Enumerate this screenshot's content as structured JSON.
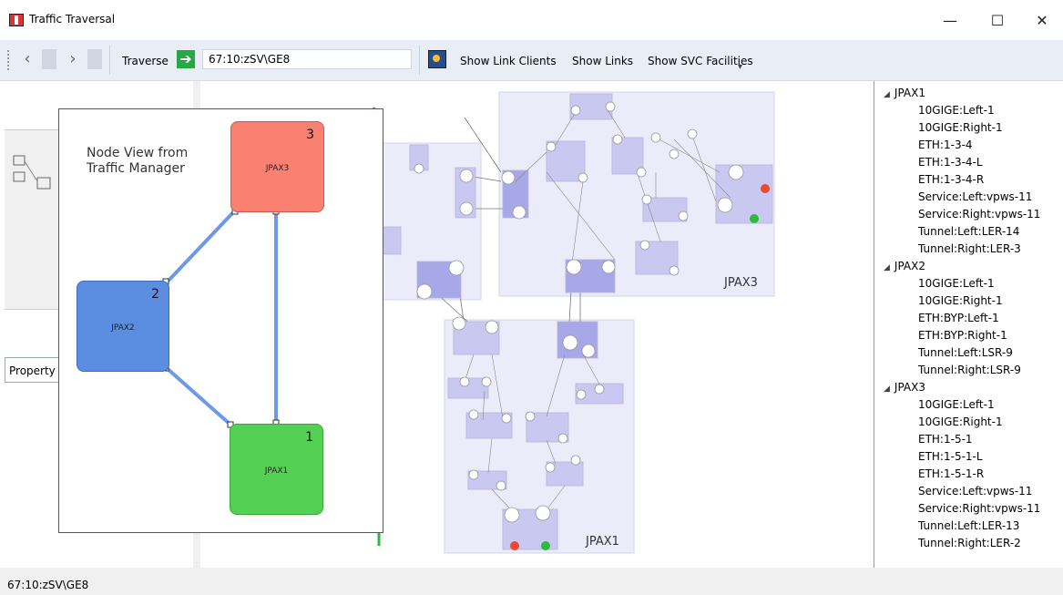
{
  "window": {
    "title": "Traffic Traversal"
  },
  "window_controls": {
    "minimize": "—",
    "maximize": "☐",
    "close": "✕"
  },
  "toolbar": {
    "back_icon": "back-arrow-icon",
    "forward_icon": "forward-arrow-icon",
    "traverse_label": "Traverse",
    "go_glyph": "➔",
    "address_value": "67:10:zSV\\GE8",
    "show_link_clients": "Show Link Clients",
    "show_links": "Show Links",
    "show_svc_facilities": "Show SVC Facilities",
    "overflow": "▾"
  },
  "left_panel": {
    "property_label": "Property"
  },
  "canvas": {
    "labels": {
      "jpax3": "JPAX3",
      "jpax1": "JPAX1"
    }
  },
  "inset": {
    "title_line1": "Node View from",
    "title_line2": "Traffic Manager",
    "nodes": [
      {
        "num": "3",
        "name": "JPAX3",
        "color": "#fa8072"
      },
      {
        "num": "2",
        "name": "JPAX2",
        "color": "#5b8ee0"
      },
      {
        "num": "1",
        "name": "JPAX1",
        "color": "#54d054"
      }
    ],
    "links": {
      "color": "#6d9ae8"
    }
  },
  "tree": {
    "groups": [
      {
        "name": "JPAX1",
        "items": [
          "10GIGE:Left-1",
          "10GIGE:Right-1",
          "ETH:1-3-4",
          "ETH:1-3-4-L",
          "ETH:1-3-4-R",
          "Service:Left:vpws-11",
          "Service:Right:vpws-11",
          "Tunnel:Left:LER-14",
          "Tunnel:Right:LER-3"
        ]
      },
      {
        "name": "JPAX2",
        "items": [
          "10GIGE:Left-1",
          "10GIGE:Right-1",
          "ETH:BYP:Left-1",
          "ETH:BYP:Right-1",
          "Tunnel:Left:LSR-9",
          "Tunnel:Right:LSR-9"
        ]
      },
      {
        "name": "JPAX3",
        "items": [
          "10GIGE:Left-1",
          "10GIGE:Right-1",
          "ETH:1-5-1",
          "ETH:1-5-1-L",
          "ETH:1-5-1-R",
          "Service:Left:vpws-11",
          "Service:Right:vpws-11",
          "Tunnel:Left:LER-13",
          "Tunnel:Right:LER-2"
        ]
      }
    ]
  },
  "status": {
    "text": "67:10:zSV\\GE8"
  },
  "colors": {
    "toolbar_bg": "#e9eef6",
    "group_panel": "#ebebfa",
    "box": "#c8c8f0",
    "box_dark": "#a8a8e8",
    "red_dot": "#e84a2c",
    "green_dot": "#2dbb3a"
  }
}
